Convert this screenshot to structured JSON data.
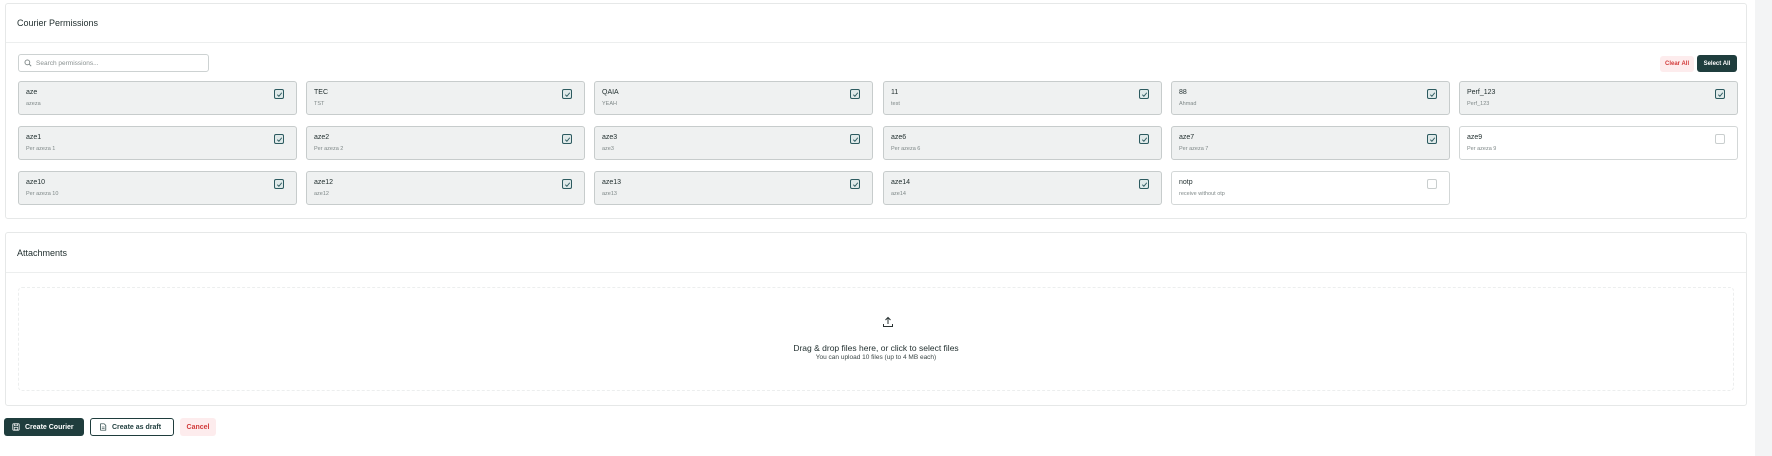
{
  "permissions_section": {
    "title": "Courier Permissions",
    "search_placeholder": "Search permissions...",
    "clear_all_label": "Clear All",
    "select_all_label": "Select All",
    "items": [
      {
        "name": "aze",
        "desc": "azeza",
        "checked": true
      },
      {
        "name": "TEC",
        "desc": "TST",
        "checked": true
      },
      {
        "name": "QAIA",
        "desc": "YEAH",
        "checked": true
      },
      {
        "name": "11",
        "desc": "test",
        "checked": true
      },
      {
        "name": "88",
        "desc": "Ahmad",
        "checked": true
      },
      {
        "name": "Perf_123",
        "desc": "Perf_123",
        "checked": true
      },
      {
        "name": "aze1",
        "desc": "Per azeza 1",
        "checked": true
      },
      {
        "name": "aze2",
        "desc": "Per azeza 2",
        "checked": true
      },
      {
        "name": "aze3",
        "desc": "aze3",
        "checked": true
      },
      {
        "name": "aze6",
        "desc": "Per azeza 6",
        "checked": true
      },
      {
        "name": "aze7",
        "desc": "Per azeza 7",
        "checked": true
      },
      {
        "name": "aze9",
        "desc": "Per azeza 9",
        "checked": false
      },
      {
        "name": "aze10",
        "desc": "Per azeza 10",
        "checked": true
      },
      {
        "name": "aze12",
        "desc": "aze12",
        "checked": true
      },
      {
        "name": "aze13",
        "desc": "aze13",
        "checked": true
      },
      {
        "name": "aze14",
        "desc": "aze14",
        "checked": true
      },
      {
        "name": "notp",
        "desc": "receive without otp",
        "checked": false
      }
    ]
  },
  "attachments_section": {
    "title": "Attachments",
    "drop_text": "Drag & drop files here, or click to select files",
    "limit_text": "You can upload 10 files (up to 4 MB each)"
  },
  "footer": {
    "create_label": "Create Courier",
    "draft_label": "Create as draft",
    "cancel_label": "Cancel"
  },
  "colors": {
    "primary": "#1f3d3d",
    "danger": "#d23c3c",
    "danger_bg": "#fdeced"
  }
}
